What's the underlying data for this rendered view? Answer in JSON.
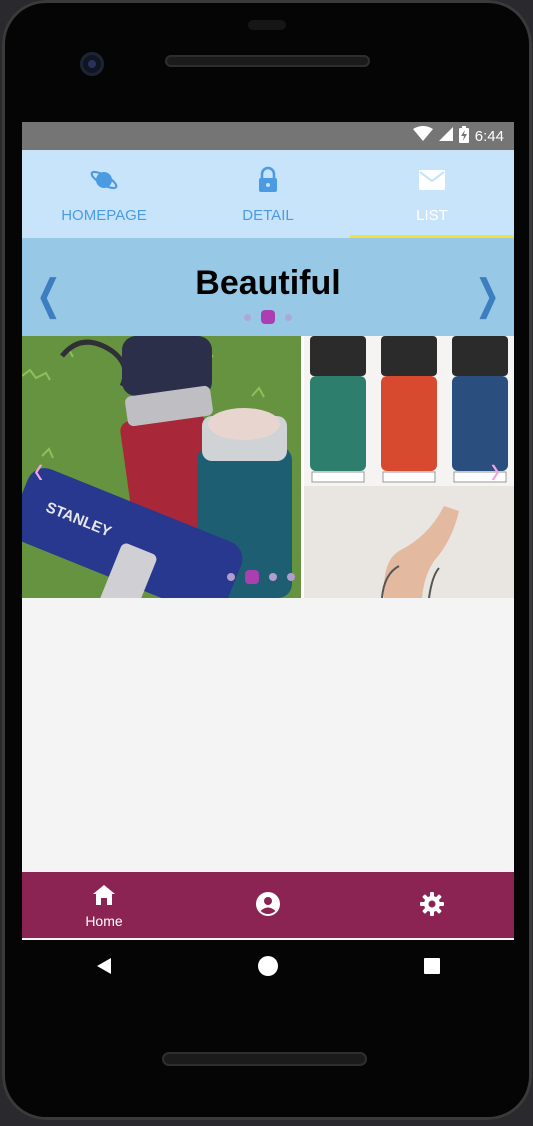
{
  "status": {
    "time": "6:44"
  },
  "topnav": {
    "tabs": [
      {
        "label": "HOMEPAGE",
        "icon": "planet-icon"
      },
      {
        "label": "DETAIL",
        "icon": "lock-icon"
      },
      {
        "label": "LIST",
        "icon": "mail-icon",
        "active": true
      }
    ]
  },
  "banner": {
    "title": "Beautiful",
    "prev": "❮",
    "next": "❯"
  },
  "carousel": {
    "prev": "‹",
    "next": "›",
    "bottle_brand": "STANLEY"
  },
  "bottomnav": {
    "items": [
      {
        "label": "Home",
        "icon": "home-icon",
        "active": true
      },
      {
        "label": "",
        "icon": "account-circle-icon"
      },
      {
        "label": "",
        "icon": "gear-icon"
      }
    ]
  },
  "colors": {
    "topnav_bg": "#c8e4fb",
    "tab_text": "#4a9be3",
    "active_indicator": "#f3e03b",
    "banner_bg": "#97c9e6",
    "bottomnav_bg": "#8b2452",
    "dot_active": "#a93fb0"
  }
}
